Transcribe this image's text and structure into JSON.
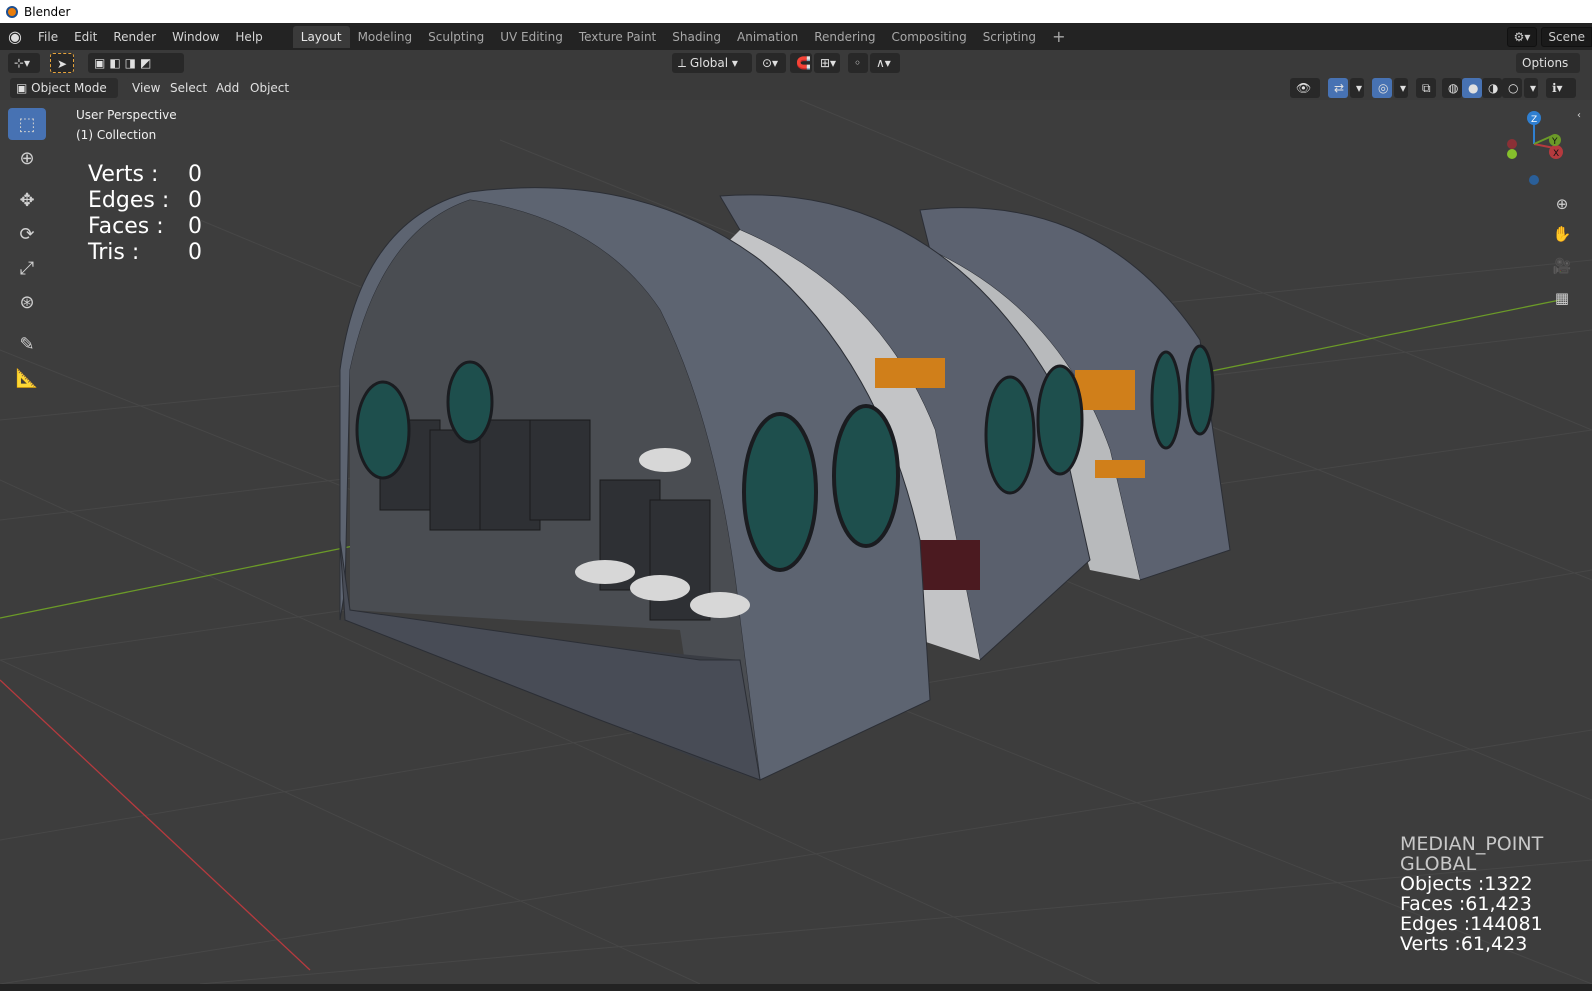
{
  "title_bar": {
    "app_title": "Blender"
  },
  "menu": {
    "file": "File",
    "edit": "Edit",
    "render": "Render",
    "window": "Window",
    "help": "Help"
  },
  "workspace_tabs": [
    {
      "label": "Layout",
      "active": true
    },
    {
      "label": "Modeling"
    },
    {
      "label": "Sculpting"
    },
    {
      "label": "UV Editing"
    },
    {
      "label": "Texture Paint"
    },
    {
      "label": "Shading"
    },
    {
      "label": "Animation"
    },
    {
      "label": "Rendering"
    },
    {
      "label": "Compositing"
    },
    {
      "label": "Scripting"
    }
  ],
  "add_workspace": "+",
  "scene_label": "Scene",
  "tool_header": {
    "transform_orientation": "Global",
    "options_label": "Options"
  },
  "viewport_header": {
    "mode": "Object Mode",
    "view": "View",
    "select": "Select",
    "add": "Add",
    "object": "Object"
  },
  "viewport": {
    "perspective": "User Perspective",
    "collection": "(1) Collection",
    "stats": {
      "verts_label": "Verts :",
      "verts": "0",
      "edges_label": "Edges :",
      "edges": "0",
      "faces_label": "Faces :",
      "faces": "0",
      "tris_label": "Tris :",
      "tris": "0"
    },
    "scene_stats": {
      "pivot": "MEDIAN_POINT",
      "orientation": "GLOBAL",
      "objects": "Objects :1322",
      "faces": "Faces :61,423",
      "edges": "Edges :144081",
      "verts": "Verts :61,423"
    },
    "gizmo": {
      "x": "X",
      "y": "Y",
      "z": "Z"
    }
  },
  "icons": {
    "select": "cursor-select-icon",
    "cursor": "3d-cursor-icon",
    "move": "move-icon",
    "rotate": "rotate-icon",
    "scale": "scale-icon",
    "transform": "transform-icon",
    "annotate": "annotate-icon",
    "measure": "measure-icon"
  },
  "colors": {
    "accent": "#4772b3",
    "axis_x": "#b53a3e",
    "axis_y": "#6b9a28",
    "axis_z": "#2f7fd1",
    "background": "#3d3d3d"
  }
}
